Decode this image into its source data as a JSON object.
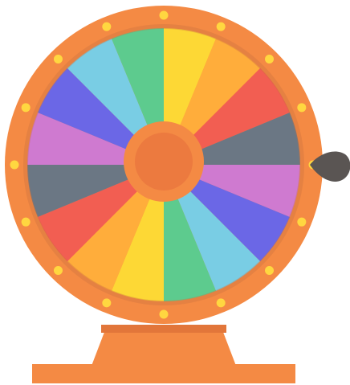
{
  "colors": {
    "frame": "#f48a44",
    "frame_shadow": "#e2763a",
    "hub": "#ec7a3f",
    "stud": "#ffd740",
    "pointer": "#5a5553",
    "rim_shadow": "#c87140"
  },
  "wheel": {
    "segments": [
      {
        "color": "#fdd835"
      },
      {
        "color": "#ffad3b"
      },
      {
        "color": "#f25e52"
      },
      {
        "color": "#6b7784"
      },
      {
        "color": "#cf7ad0"
      },
      {
        "color": "#6b67e6"
      },
      {
        "color": "#79cde4"
      },
      {
        "color": "#5dcb8e"
      },
      {
        "color": "#fdd835"
      },
      {
        "color": "#ffad3b"
      },
      {
        "color": "#f25e52"
      },
      {
        "color": "#6b7784"
      },
      {
        "color": "#cf7ad0"
      },
      {
        "color": "#6b67e6"
      },
      {
        "color": "#79cde4"
      },
      {
        "color": "#5dcb8e"
      }
    ],
    "stud_count": 16
  },
  "pointer": {
    "icon": "pointer-icon"
  }
}
